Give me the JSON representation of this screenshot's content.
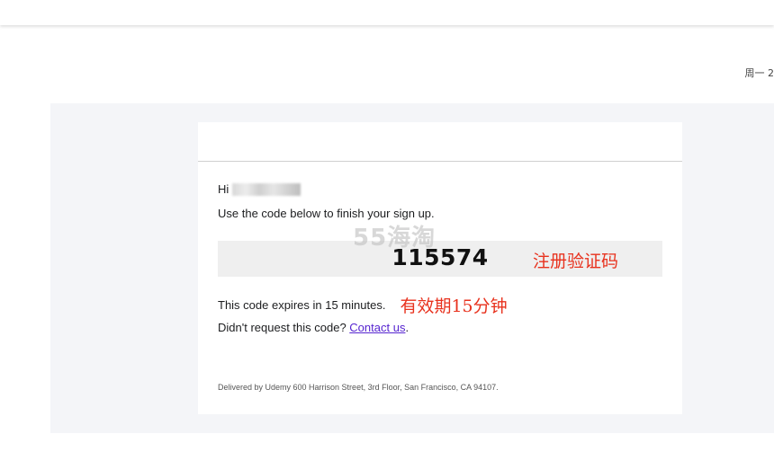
{
  "header": {
    "date_fragment": "周一 2"
  },
  "email": {
    "greeting_prefix": "Hi",
    "instruction": "Use the code below to finish your sign up.",
    "code": "115574",
    "code_annotation": "注册验证码",
    "watermark": "55海淘",
    "expiry_text": "This code expires in 15 minutes.",
    "expiry_annotation": "有效期15分钟",
    "didnt_request_prefix": "Didn't request this code? ",
    "contact_link": "Contact us",
    "didnt_request_suffix": ".",
    "footer": "Delivered by Udemy 600 Harrison Street, 3rd Floor, San Francisco, CA 94107."
  },
  "colors": {
    "annotation": "#e8321e",
    "link": "#5624d0",
    "code_box_bg": "#efefef",
    "mail_bg": "#f4f5f8"
  }
}
